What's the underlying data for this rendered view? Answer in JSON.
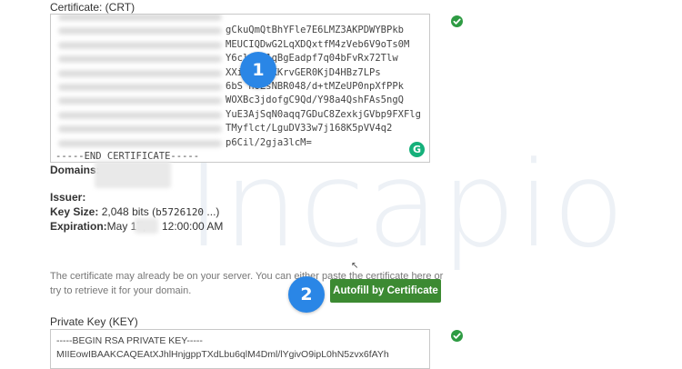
{
  "watermark": {
    "text": "Incapio"
  },
  "certificate": {
    "label": "Certificate: (CRT)",
    "lines": [
      "gCkuQmQtBhYFle7E6LMZ3AKPDWYBPkb",
      "MEUCIQDwG2LqXDQxtfM4zVeb6V9oTs0M",
      "Y6clzbV1qBgEadpf7q04bFvRx72Tlw",
      "XXi     im4lKKrvGER0KjD4HBz7LPs",
      "6bS     hOZsNBR048/d+tMZeUP0npXfPPk",
      "WOXBc3jdofgC9Qd/Y98a4QshFAs5ngQ",
      "YuE3AjSqN0aqq7GDuC8ZexkjGVbp9FXFlg",
      "TMyflct/LguDV33w7j168K5pVV4q2",
      "p6Cil/2gja3lcM="
    ],
    "end_line": "-----END CERTIFICATE-----"
  },
  "details": {
    "domains_label": "Domains:",
    "issuer_label": "Issuer:",
    "key_size_label": "Key Size:",
    "key_size_value": "2,048 bits (",
    "key_size_hash": "b5726120",
    "key_size_suffix": " ...)",
    "expiration_label": "Expiration:",
    "expiration_month": "May 17,",
    "expiration_time": "12:00:00 AM"
  },
  "note": {
    "line1": "The certificate may already be on your server. You can either paste the certificate here or",
    "line2": "try to retrieve it for your domain."
  },
  "autofill_button": {
    "label": "Autofill by Certificate"
  },
  "private_key": {
    "label": "Private Key (KEY)",
    "begin_line": "-----BEGIN RSA PRIVATE KEY-----",
    "line1": "MIIEowIBAAKCAQEAtXJhlHnjgppTXdLbu6qlM4Dml/lYgivO9ipL0hN5zvx6fAYh"
  },
  "badges": {
    "one": "1",
    "two": "2"
  },
  "colors": {
    "accent": "#2a86e6",
    "button": "#3c8a32",
    "check": "#2e9b43"
  }
}
